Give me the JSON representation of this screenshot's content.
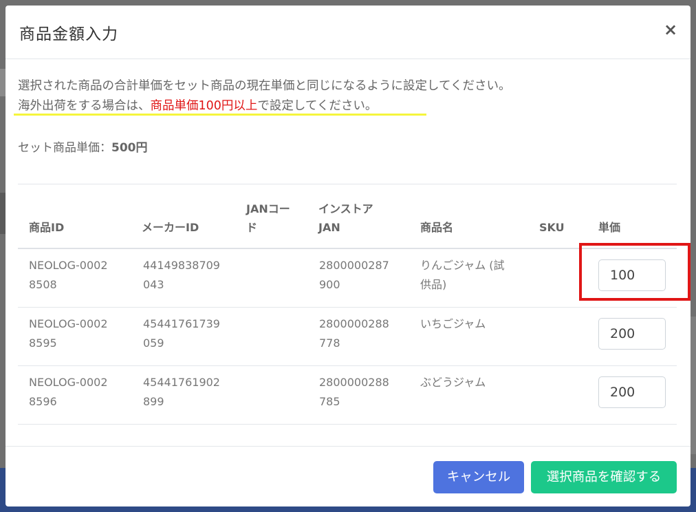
{
  "modal": {
    "title": "商品金額入力",
    "close_label": "×"
  },
  "description": {
    "line1": "選択された商品の合計単価をセット商品の現在単価と同じになるように設定してください。",
    "line2_prefix": "海外出荷をする場合は、",
    "line2_highlight": "商品単価100円以上",
    "line2_suffix": "で設定してください。"
  },
  "set_price": {
    "label": "セット商品単価：",
    "value": "500円"
  },
  "table": {
    "headers": {
      "product_id": "商品ID",
      "maker_id": "メーカーID",
      "jan_code_1": "JANコー",
      "jan_code_2": "ド",
      "instore_jan_1": "インストア",
      "instore_jan_2": "JAN",
      "product_name": "商品名",
      "sku": "SKU",
      "unit_price": "単価"
    },
    "rows": [
      {
        "product_id_1": "NEOLOG-0002",
        "product_id_2": "8508",
        "maker_id_1": "44149838709",
        "maker_id_2": "043",
        "jan_code": "",
        "instore_jan_1": "2800000287",
        "instore_jan_2": "900",
        "product_name_1": "りんごジャム (試",
        "product_name_2": "供品)",
        "sku": "",
        "unit_price": "100"
      },
      {
        "product_id_1": "NEOLOG-0002",
        "product_id_2": "8595",
        "maker_id_1": "45441761739",
        "maker_id_2": "059",
        "jan_code": "",
        "instore_jan_1": "2800000288",
        "instore_jan_2": "778",
        "product_name_1": "いちごジャム",
        "product_name_2": "",
        "sku": "",
        "unit_price": "200"
      },
      {
        "product_id_1": "NEOLOG-0002",
        "product_id_2": "8596",
        "maker_id_1": "45441761902",
        "maker_id_2": "899",
        "jan_code": "",
        "instore_jan_1": "2800000288",
        "instore_jan_2": "785",
        "product_name_1": "ぶどうジャム",
        "product_name_2": "",
        "sku": "",
        "unit_price": "200"
      }
    ]
  },
  "footer": {
    "cancel_label": "キャンセル",
    "confirm_label": "選択商品を確認する"
  },
  "colors": {
    "primary": "#4e73df",
    "success": "#1cc88a",
    "highlight_red": "#e01515",
    "underline_yellow": "#f5f53c"
  }
}
